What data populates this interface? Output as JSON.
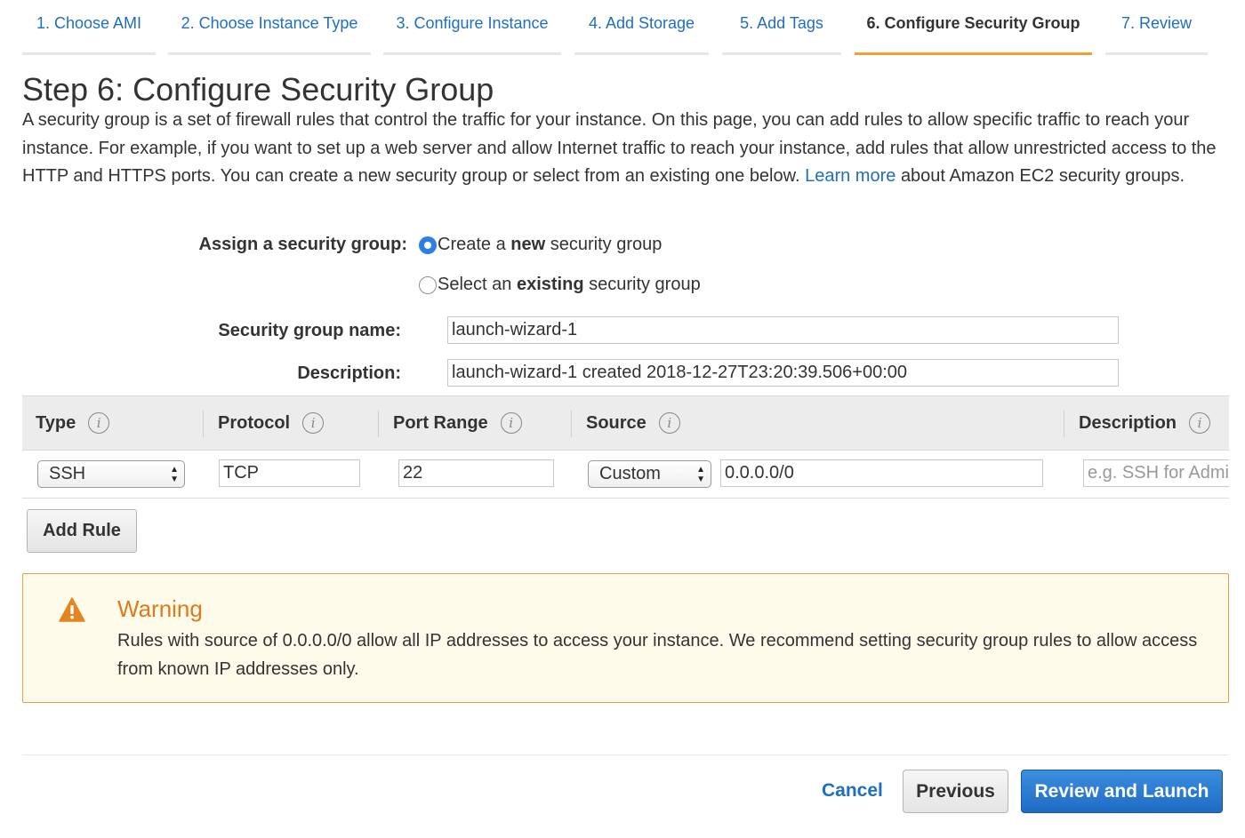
{
  "wizard_tabs": [
    {
      "label": "1. Choose AMI",
      "active": false
    },
    {
      "label": "2. Choose Instance Type",
      "active": false
    },
    {
      "label": "3. Configure Instance",
      "active": false
    },
    {
      "label": "4. Add Storage",
      "active": false
    },
    {
      "label": "5. Add Tags",
      "active": false
    },
    {
      "label": "6. Configure Security Group",
      "active": true
    },
    {
      "label": "7. Review",
      "active": false
    }
  ],
  "page": {
    "title": "Step 6: Configure Security Group",
    "intro_text": "A security group is a set of firewall rules that control the traffic for your instance. On this page, you can add rules to allow specific traffic to reach your instance. For example, if you want to set up a web server and allow Internet traffic to reach your instance, add rules that allow unrestricted access to the HTTP and HTTPS ports. You can create a new security group or select from an existing one below.",
    "learn_more_link": "Learn more",
    "intro_suffix": "about Amazon EC2 security groups."
  },
  "assign": {
    "label": "Assign a security group:",
    "options": [
      {
        "prefix": "Create a ",
        "bold": "new",
        "suffix": " security group",
        "selected": true
      },
      {
        "prefix": "Select an ",
        "bold": "existing",
        "suffix": " security group",
        "selected": false
      }
    ]
  },
  "form": {
    "name_label": "Security group name:",
    "name_value": "launch-wizard-1",
    "description_label": "Description:",
    "description_value": "launch-wizard-1 created 2018-12-27T23:20:39.506+00:00"
  },
  "rules_table": {
    "headers": [
      "Type",
      "Protocol",
      "Port Range",
      "Source",
      "Description"
    ],
    "info_symbol": "i",
    "rows": [
      {
        "type": "SSH",
        "protocol": "TCP",
        "port_range": "22",
        "source_mode": "Custom",
        "source_cidr": "0.0.0.0/0",
        "description_placeholder": "e.g. SSH for Admin Desktop"
      }
    ]
  },
  "add_rule_label": "Add Rule",
  "warning": {
    "title": "Warning",
    "text": "Rules with source of 0.0.0.0/0 allow all IP addresses to access your instance. We recommend setting security group rules to allow access from known IP addresses only.",
    "accent_color": "#dd7a1a"
  },
  "footer": {
    "cancel_label": "Cancel",
    "previous_label": "Previous",
    "review_launch_label": "Review and Launch"
  },
  "colors": {
    "link": "#1f6fbf",
    "active_tab_underline": "#f0a030",
    "primary_button": "#1f6cc4"
  }
}
